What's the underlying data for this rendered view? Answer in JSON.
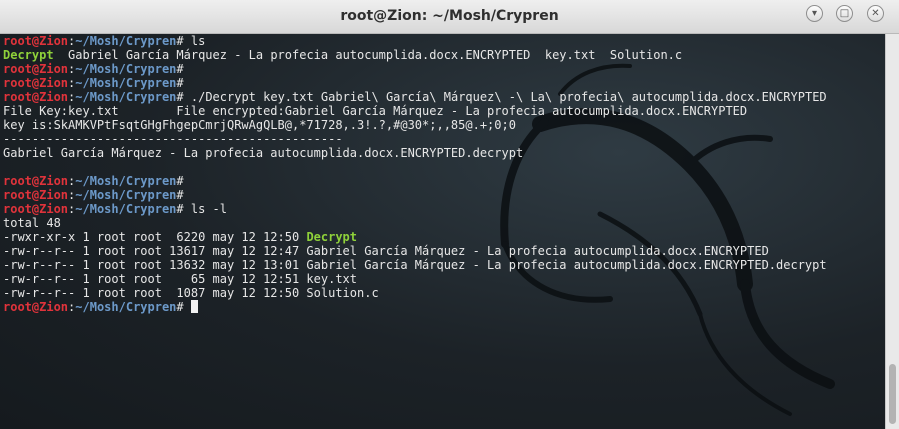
{
  "window": {
    "title": "root@Zion: ~/Mosh/Crypren",
    "buttons": {
      "minimize": "minimize-icon",
      "maximize": "maximize-icon",
      "close": "close-icon"
    }
  },
  "colors": {
    "user": "#e0333b",
    "path": "#6c99c9",
    "executable": "#8fd13a",
    "text": "#e7e7e7"
  },
  "prompt": {
    "user": "root@Zion",
    "separator": ":",
    "path": "~/Mosh/Crypren",
    "symbol": "#"
  },
  "lines": [
    {
      "type": "prompt",
      "cmd": " ls"
    },
    {
      "type": "ls",
      "items": [
        {
          "text": "Decrypt",
          "exe": true
        },
        {
          "text": "  Gabriel García Márquez - La profecia autocumplida.docx.ENCRYPTED  key.txt  Solution.c",
          "exe": false
        }
      ]
    },
    {
      "type": "prompt",
      "cmd": ""
    },
    {
      "type": "prompt",
      "cmd": ""
    },
    {
      "type": "prompt",
      "cmd": " ./Decrypt key.txt Gabriel\\ García\\ Márquez\\ -\\ La\\ profecia\\ autocumplida.docx.ENCRYPTED"
    },
    {
      "type": "text",
      "text": "File Key:key.txt        File encrypted:Gabriel García Márquez - La profecia autocumplida.docx.ENCRYPTED"
    },
    {
      "type": "text",
      "text": "key is:SkAMKVPtFsqtGHgFhgepCmrjQRwAgQLB@,*71728,.3!.?,#@30*;,,85@.+;0;0"
    },
    {
      "type": "text",
      "text": "-----------------------------------------------"
    },
    {
      "type": "text",
      "text": "Gabriel García Márquez - La profecia autocumplida.docx.ENCRYPTED.decrypt"
    },
    {
      "type": "text",
      "text": ""
    },
    {
      "type": "prompt",
      "cmd": ""
    },
    {
      "type": "prompt",
      "cmd": ""
    },
    {
      "type": "prompt",
      "cmd": " ls -l"
    },
    {
      "type": "text",
      "text": "total 48"
    },
    {
      "type": "ls",
      "items": [
        {
          "text": "-rwxr-xr-x 1 root root  6220 may 12 12:50 ",
          "exe": false
        },
        {
          "text": "Decrypt",
          "exe": true
        }
      ]
    },
    {
      "type": "text",
      "text": "-rw-r--r-- 1 root root 13617 may 12 12:47 Gabriel García Márquez - La profecia autocumplida.docx.ENCRYPTED"
    },
    {
      "type": "text",
      "text": "-rw-r--r-- 1 root root 13632 may 12 13:01 Gabriel García Márquez - La profecia autocumplida.docx.ENCRYPTED.decrypt"
    },
    {
      "type": "text",
      "text": "-rw-r--r-- 1 root root    65 may 12 12:51 key.txt"
    },
    {
      "type": "text",
      "text": "-rw-r--r-- 1 root root  1087 may 12 12:50 Solution.c"
    },
    {
      "type": "prompt",
      "cmd": " ",
      "cursor": true
    }
  ]
}
